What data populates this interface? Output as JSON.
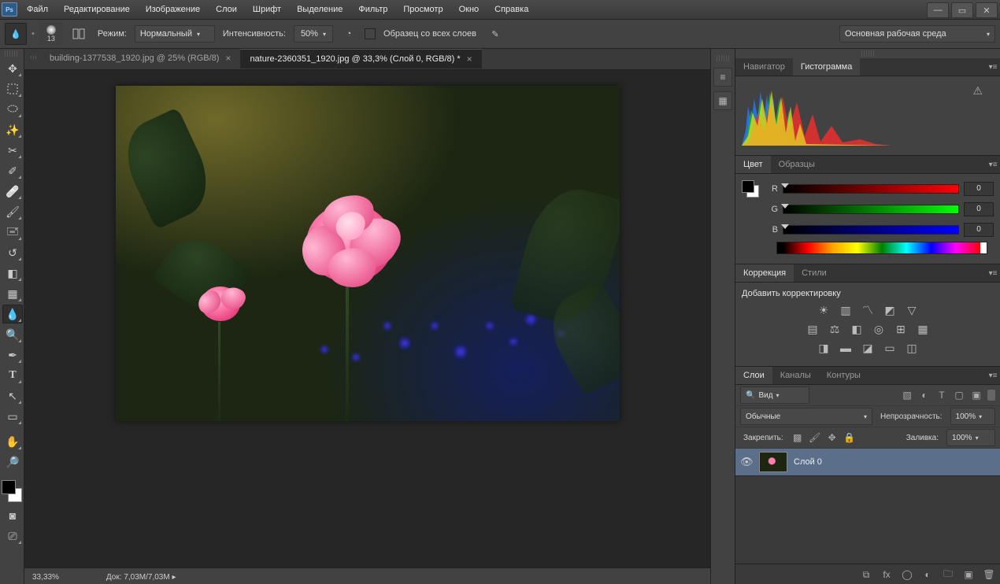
{
  "app": {
    "logo": "Ps"
  },
  "menu": [
    "Файл",
    "Редактирование",
    "Изображение",
    "Слои",
    "Шрифт",
    "Выделение",
    "Фильтр",
    "Просмотр",
    "Окно",
    "Справка"
  ],
  "optbar": {
    "brush_size": "13",
    "mode_lbl": "Режим:",
    "mode_val": "Нормальный",
    "intensity_lbl": "Интенсивность:",
    "intensity_val": "50%",
    "sample_all": "Образец со всех слоев",
    "workspace": "Основная рабочая среда"
  },
  "tabs": [
    {
      "label": "building-1377538_1920.jpg @ 25% (RGB/8)",
      "active": false
    },
    {
      "label": "nature-2360351_1920.jpg @ 33,3% (Слой 0, RGB/8) *",
      "active": true
    }
  ],
  "status": {
    "zoom": "33,33%",
    "doc_lbl": "Док:",
    "doc_val": "7,03M/7,03M"
  },
  "panels": {
    "nav": {
      "tab1": "Навигатор",
      "tab2": "Гистограмма"
    },
    "color": {
      "tab1": "Цвет",
      "tab2": "Образцы",
      "r": "R",
      "g": "G",
      "b": "B",
      "rv": "0",
      "gv": "0",
      "bv": "0"
    },
    "adj": {
      "tab1": "Коррекция",
      "tab2": "Стили",
      "add": "Добавить корректировку"
    },
    "layers": {
      "t1": "Слои",
      "t2": "Каналы",
      "t3": "Контуры",
      "kind": "Вид",
      "blend": "Обычные",
      "opacity_lbl": "Непрозрачность:",
      "opacity": "100%",
      "lock_lbl": "Закрепить:",
      "fill_lbl": "Заливка:",
      "fill": "100%",
      "layer0": "Слой 0"
    }
  }
}
